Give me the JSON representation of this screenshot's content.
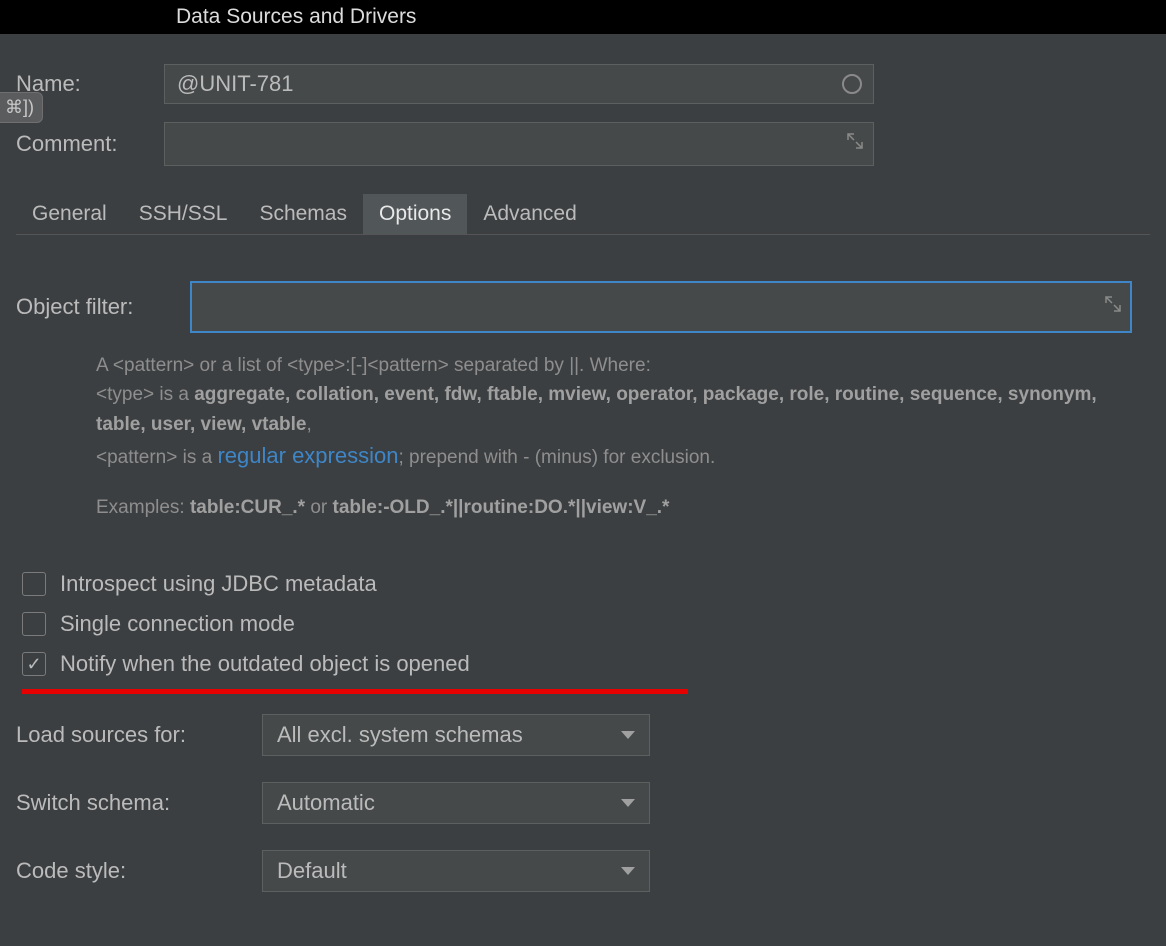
{
  "title": "Data Sources and Drivers",
  "cmdBadge": "⌘])",
  "form": {
    "nameLabel": "Name:",
    "nameValue": "@UNIT-781",
    "commentLabel": "Comment:",
    "commentValue": ""
  },
  "tabs": [
    {
      "label": "General",
      "selected": false
    },
    {
      "label": "SSH/SSL",
      "selected": false
    },
    {
      "label": "Schemas",
      "selected": false
    },
    {
      "label": "Options",
      "selected": true
    },
    {
      "label": "Advanced",
      "selected": false
    }
  ],
  "objectFilter": {
    "label": "Object filter:",
    "value": "",
    "help": {
      "line1_pre": "A <pattern> or a list of <type>:[-]<pattern> separated by ||. Where:",
      "line2_pre": "<type> is a ",
      "types": "aggregate, collation, event, fdw, ftable, mview, operator, package, role, routine, sequence, synonym, table, user, view, vtable",
      "line3_pre": "<pattern> is a ",
      "regex": "regular expression",
      "line3_post": "; prepend with - (minus) for exclusion.",
      "ex_pre": "Examples: ",
      "ex1": "table:CUR_.*",
      "ex_mid": " or ",
      "ex2": "table:-OLD_.*||routine:DO.*||view:V_.*"
    }
  },
  "checks": {
    "jdbc": {
      "label": "Introspect using JDBC metadata",
      "checked": false
    },
    "single": {
      "label": "Single connection mode",
      "checked": false
    },
    "notify": {
      "label": "Notify when the outdated object is opened",
      "checked": true
    }
  },
  "dropdowns": {
    "loadSources": {
      "label": "Load sources for:",
      "value": "All excl. system schemas"
    },
    "switchSchema": {
      "label": "Switch schema:",
      "value": "Automatic"
    },
    "codeStyle": {
      "label": "Code style:",
      "value": "Default"
    }
  }
}
